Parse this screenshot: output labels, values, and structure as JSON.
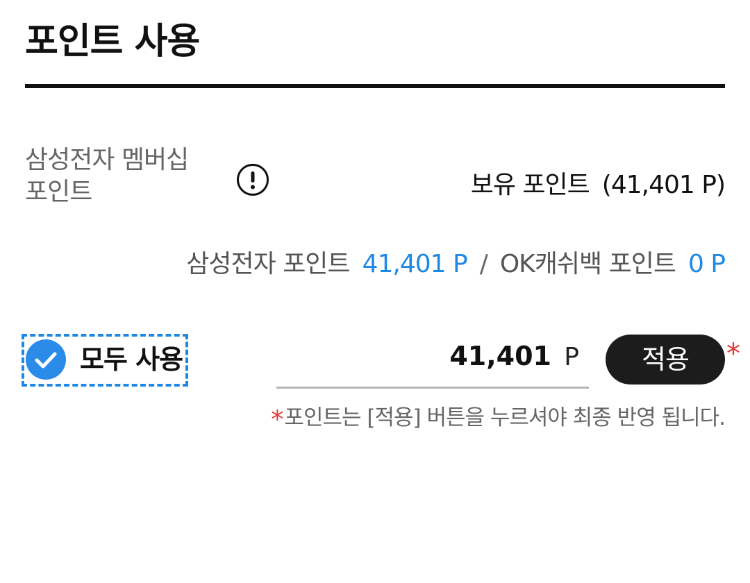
{
  "header": {
    "title": "포인트 사용"
  },
  "membership": {
    "label_line1": "삼성전자 멤버십",
    "label_line2": "포인트",
    "info_icon": "exclamation-circle-icon",
    "owned_label": "보유 포인트",
    "owned_value": "(41,401 P)"
  },
  "breakdown": {
    "samsung_label": "삼성전자 포인트",
    "samsung_value": "41,401 P",
    "separator": "/",
    "okcashbag_label": "OK캐쉬백 포인트",
    "okcashbag_value": "0 P"
  },
  "use_all": {
    "label": "모두 사용",
    "checked": true,
    "icon": "check-circle-icon"
  },
  "amount_input": {
    "value": "41,401",
    "unit": "P"
  },
  "apply_button": {
    "label": "적용"
  },
  "required_mark": "*",
  "notice": {
    "star": "*",
    "text": "포인트는 [적용] 버튼을 누르셔야 최종 반영 됩니다."
  },
  "colors": {
    "accent_blue": "#1e88e5",
    "required_red": "#e53935",
    "button_dark": "#1c1c1c",
    "text_dark": "#111111",
    "text_gray": "#666666"
  }
}
